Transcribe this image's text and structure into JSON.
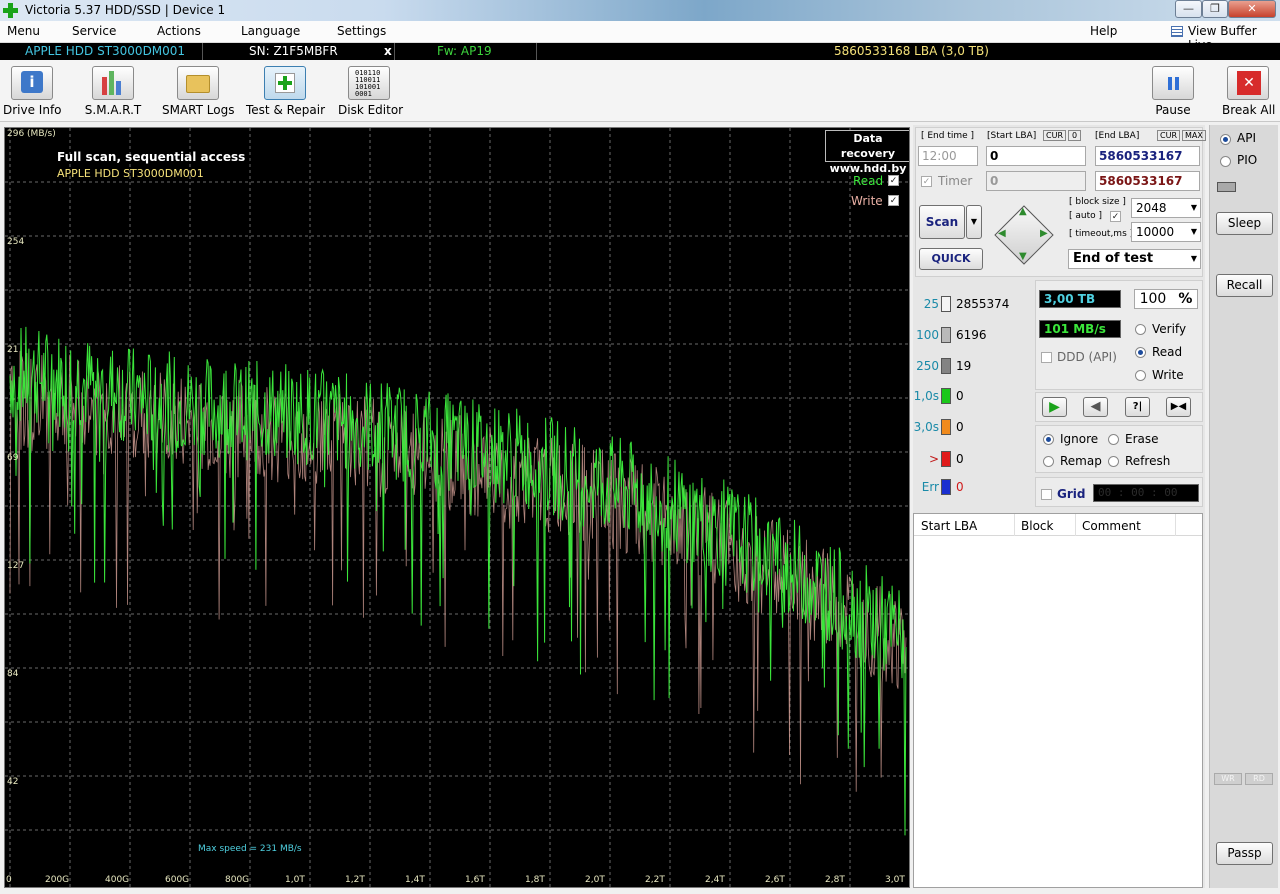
{
  "window": {
    "title": "Victoria 5.37 HDD/SSD | Device 1",
    "min": "—",
    "max": "❐",
    "close": "✕"
  },
  "menu": {
    "items": [
      "Menu",
      "Service",
      "Actions",
      "Language",
      "Settings"
    ],
    "help": "Help",
    "view_buffer": "View Buffer Live"
  },
  "infobar": {
    "model": "APPLE HDD ST3000DM001",
    "serial": "SN: Z1F5MBFR",
    "close": "x",
    "firmware": "Fw: AP19",
    "lba": "5860533168 LBA (3,0 TB)"
  },
  "toolbar": {
    "buttons": [
      "Drive Info",
      "S.M.A.R.T",
      "SMART Logs",
      "Test & Repair",
      "Disk Editor"
    ],
    "pause": "Pause",
    "break_all": "Break All"
  },
  "graph": {
    "title": "Full scan, sequential access",
    "model": "APPLE HDD ST3000DM001",
    "recovery_line1": "Data recovery",
    "recovery_line2": "www.hdd.by",
    "legend_read": "Read",
    "legend_write": "Write",
    "max_speed": "Max speed = 231 MB/s",
    "y_labels": [
      "296 (MB/s)",
      "254",
      "21",
      "69",
      "127",
      "84",
      "42"
    ],
    "x_labels": [
      "0",
      "200G",
      "400G",
      "600G",
      "800G",
      "1,0T",
      "1,2T",
      "1,4T",
      "1,6T",
      "1,8T",
      "2,0T",
      "2,2T",
      "2,4T",
      "2,6T",
      "2,8T",
      "3,0T"
    ],
    "colors": {
      "read": "#3be63b",
      "write": "#e9b0a5",
      "grid": "#6a6a6a"
    }
  },
  "chart_data": {
    "type": "line",
    "title": "Full scan, sequential access",
    "ylabel": "(MB/s)",
    "ylim": [
      0,
      296
    ],
    "x_unit": "TB",
    "x": [
      0.0,
      0.2,
      0.4,
      0.6,
      0.8,
      1.0,
      1.2,
      1.4,
      1.6,
      1.8,
      2.0,
      2.2,
      2.4,
      2.6,
      2.8,
      3.0
    ],
    "series": [
      {
        "name": "Read",
        "values": [
          200,
          198,
          192,
          188,
          186,
          184,
          180,
          175,
          170,
          164,
          157,
          149,
          138,
          125,
          110,
          95
        ]
      },
      {
        "name": "Write",
        "values": [
          190,
          188,
          184,
          180,
          178,
          176,
          172,
          168,
          162,
          156,
          150,
          142,
          132,
          120,
          106,
          92
        ]
      }
    ]
  },
  "controls": {
    "end_time": "[ End time ]",
    "start_lba": "[Start LBA]",
    "cur": "CUR",
    "zero": "0",
    "end_lba": "[End LBA]",
    "max": "MAX",
    "time_value": "12:00",
    "start_value": "0",
    "end_value": "5860533167",
    "timer": "Timer",
    "timer_value": "0",
    "end_value2": "5860533167",
    "scan": "Scan",
    "quick": "QUICK",
    "block_size": "[ block size ]",
    "auto": "[ auto ]",
    "block_value": "2048",
    "timeout": "[ timeout,ms ]",
    "timeout_value": "10000",
    "end_of_test": "End of test"
  },
  "stats": {
    "blocks": [
      {
        "label": "25",
        "value": "2855374",
        "color": "#f4f4f4"
      },
      {
        "label": "100",
        "value": "6196",
        "color": "#b9b9b9"
      },
      {
        "label": "250",
        "value": "19",
        "color": "#838383"
      },
      {
        "label": "1,0s",
        "value": "0",
        "color": "#19c819"
      },
      {
        "label": "3,0s",
        "value": "0",
        "color": "#f08a1c"
      },
      {
        "label": ">",
        "value": "0",
        "color": "#e01b1b"
      },
      {
        "label": "Err",
        "value": "0",
        "color": "#1a2fd0"
      }
    ],
    "size": "3,00 TB",
    "percent": "100",
    "percent_sign": "%",
    "speed": "101 MB/s",
    "ddd": "DDD (API)",
    "mode": [
      "Verify",
      "Read",
      "Write"
    ],
    "action": [
      "Ignore",
      "Erase",
      "Remap",
      "Refresh"
    ],
    "grid": "Grid",
    "clock": "00 : 00 : 00"
  },
  "table": {
    "columns": [
      "Start LBA",
      "Block",
      "Comment"
    ]
  },
  "side": {
    "api": "API",
    "pio": "PIO",
    "sleep": "Sleep",
    "recall": "Recall",
    "passp": "Passp",
    "wr": "WR",
    "rd": "RD"
  }
}
